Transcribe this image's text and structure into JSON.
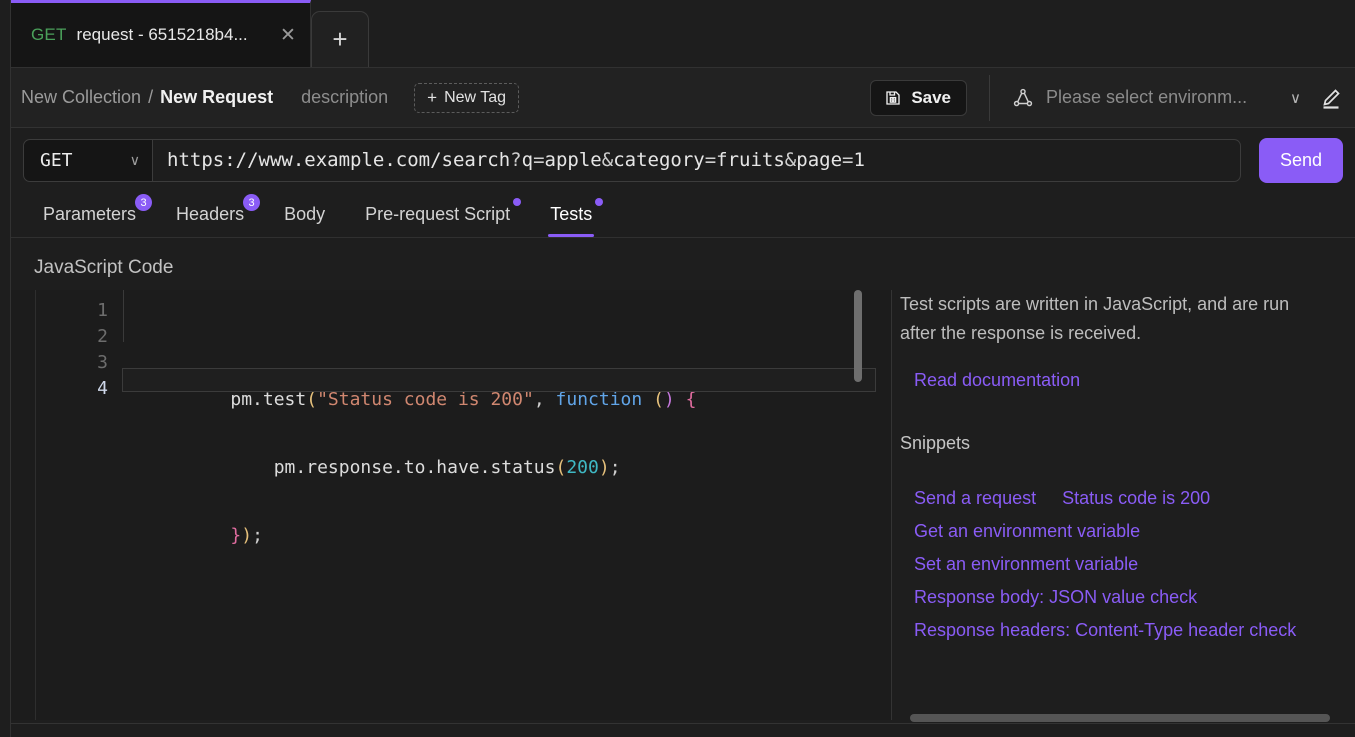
{
  "tab_strip": {
    "tabs": [
      {
        "method": "GET",
        "title": "request - 6515218b4...",
        "close_icon": "close-icon",
        "active": true
      }
    ],
    "new_tab_label": "+"
  },
  "header": {
    "collection": "New Collection",
    "separator": "/",
    "request_name": "New Request",
    "description_placeholder": "description",
    "new_tag_label": "New Tag",
    "new_tag_plus": "+",
    "save_label": "Save",
    "save_icon": "floppy-disk-icon",
    "environment_icon": "network-nodes-icon",
    "environment_placeholder": "Please select environm...",
    "environment_caret": "∨",
    "edit_icon": "pencil-edit-icon"
  },
  "url_bar": {
    "method": "GET",
    "method_caret": "∨",
    "url_full": "https://www.example.com/search?q=apple&category=fruits&page=1",
    "url_parts": {
      "base": "https://www.example.com/search",
      "question": "?",
      "p1_key": "q",
      "p1_eq": "=",
      "p1_val": "apple",
      "amp1": "&",
      "p2_key": "category",
      "p2_eq": "=",
      "p2_val": "fruits",
      "amp2": "&",
      "p3_key": "page",
      "p3_eq": "=",
      "p3_val": "1"
    },
    "send_label": "Send"
  },
  "request_tabs": [
    {
      "label": "Parameters",
      "badge": "3",
      "dot": false,
      "active": false
    },
    {
      "label": "Headers",
      "badge": "3",
      "dot": false,
      "active": false
    },
    {
      "label": "Body",
      "badge": null,
      "dot": false,
      "active": false
    },
    {
      "label": "Pre-request Script",
      "badge": null,
      "dot": true,
      "active": false
    },
    {
      "label": "Tests",
      "badge": null,
      "dot": true,
      "active": true
    }
  ],
  "editor": {
    "section_title": "JavaScript Code",
    "line_numbers": [
      "1",
      "2",
      "3",
      "4"
    ],
    "active_line": "4",
    "lines": [
      {
        "n": 1,
        "tokens": [
          {
            "t": "pm.test",
            "c": "plain"
          },
          {
            "t": "(",
            "c": "paren1"
          },
          {
            "t": "\"Status code is 200\"",
            "c": "string"
          },
          {
            "t": ", ",
            "c": "punc"
          },
          {
            "t": "function",
            "c": "kw"
          },
          {
            "t": " ",
            "c": "plain"
          },
          {
            "t": "(",
            "c": "paren2"
          },
          {
            "t": ")",
            "c": "paren2"
          },
          {
            "t": " ",
            "c": "plain"
          },
          {
            "t": "{",
            "c": "brace"
          }
        ]
      },
      {
        "n": 2,
        "tokens": [
          {
            "t": "    pm.response.to.have.status",
            "c": "plain"
          },
          {
            "t": "(",
            "c": "paren1"
          },
          {
            "t": "200",
            "c": "num"
          },
          {
            "t": ")",
            "c": "paren1"
          },
          {
            "t": ";",
            "c": "punc"
          }
        ]
      },
      {
        "n": 3,
        "tokens": [
          {
            "t": "}",
            "c": "brace"
          },
          {
            "t": ")",
            "c": "paren1"
          },
          {
            "t": ";",
            "c": "punc"
          }
        ]
      },
      {
        "n": 4,
        "tokens": []
      }
    ]
  },
  "help": {
    "description": "Test scripts are written in JavaScript, and are run after the response is received.",
    "doc_link": "Read documentation",
    "snippets_title": "Snippets",
    "snippets_row1": [
      "Send a request",
      "Status code is 200"
    ],
    "snippets_rest": [
      "Get an environment variable",
      "Set an environment variable",
      "Response body: JSON value check",
      "Response headers: Content-Type header check"
    ]
  },
  "colors": {
    "accent": "#8a5cf6",
    "background": "#1e1e1e",
    "editor_background": "#1c1c1c",
    "method_get": "#4aa05a",
    "link": "#8a5cf6"
  }
}
